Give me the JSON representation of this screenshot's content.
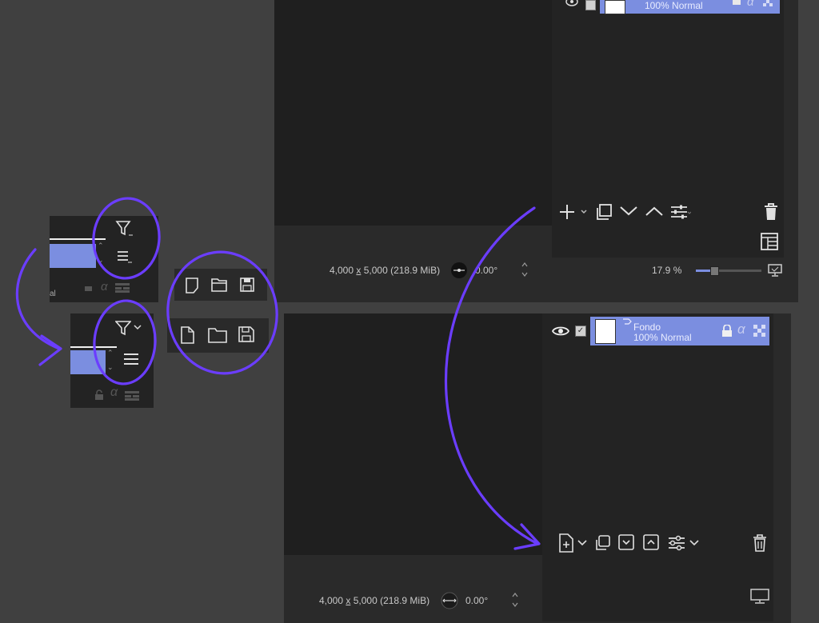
{
  "accent_colors": {
    "layer_highlight": "#7b8ee0",
    "annotation": "#6b3dff",
    "background": "#404040"
  },
  "top_window": {
    "layer": {
      "mode": "100% Normal"
    },
    "statusbar": {
      "dimensions_prefix": "4,000 ",
      "dimensions_x": "x",
      "dimensions_suffix": " 5,000 (218.9 MiB)",
      "rotation": "0.00°",
      "zoom": "17.9 %"
    },
    "toolbar_icons": [
      "add-layer-icon",
      "chevron-down-icon",
      "duplicate-layer-icon",
      "move-down-icon",
      "move-up-icon",
      "layer-properties-icon",
      "delete-icon",
      "layout-icon"
    ]
  },
  "bottom_window": {
    "layer": {
      "name": "Fondo",
      "mode": "100% Normal"
    },
    "statusbar": {
      "dimensions_prefix": "4,000 ",
      "dimensions_x": "x",
      "dimensions_suffix": " 5,000 (218.9 MiB)",
      "rotation": "0.00°"
    },
    "toolbar_icons": [
      "add-layer-icon",
      "chevron-down-icon",
      "duplicate-layer-icon",
      "move-down-icon",
      "move-up-icon",
      "layer-properties-icon",
      "chevron-down-icon",
      "delete-icon"
    ]
  },
  "comparison_old": {
    "layer_mode_fragment": "al",
    "icons": [
      "filter-icon",
      "menu-icon",
      "lock-icon",
      "alpha-icon",
      "inherit-alpha-icon"
    ]
  },
  "comparison_new": {
    "icons": [
      "filter-icon",
      "chevron-down-icon",
      "menu-icon",
      "lock-icon",
      "alpha-icon",
      "inherit-alpha-icon"
    ]
  },
  "file_icons_old": [
    "new-file-icon",
    "open-folder-icon",
    "save-icon"
  ],
  "file_icons_new": [
    "new-file-icon",
    "open-folder-icon",
    "save-icon"
  ],
  "alpha_glyph": "α"
}
